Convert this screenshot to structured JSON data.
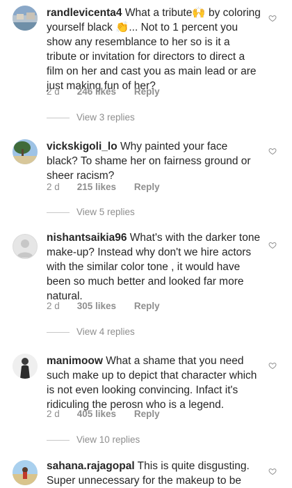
{
  "comments": [
    {
      "username": "randlevicenta4",
      "text": "What a tribute🙌 by coloring yourself black 👏... Not to 1 percent you show any resemblance to her so is it a tribute or invitation for directors to direct a film on her and cast you as main lead or are just making fun of her?",
      "age": "2 d",
      "likes": "246 likes",
      "reply": "Reply",
      "replies": "View 3 replies"
    },
    {
      "username": "vickskigoli_lo",
      "text": "Why painted your face black? To shame her on fairness ground or sheer racism?",
      "age": "2 d",
      "likes": "215 likes",
      "reply": "Reply",
      "replies": "View 5 replies"
    },
    {
      "username": "nishantsaikia96",
      "text": "What's with the darker tone make-up? Instead why don't we hire actors with the similar color tone , it would have been so much better and looked far more natural.",
      "age": "2 d",
      "likes": "305 likes",
      "reply": "Reply",
      "replies": "View 4 replies"
    },
    {
      "username": "manimoow",
      "text": "What a shame that you need such make up to depict that character which is not even looking convincing. Infact it's ridiculing the perosn who is a legend.",
      "age": "2 d",
      "likes": "405 likes",
      "reply": "Reply",
      "replies": "View 10 replies"
    },
    {
      "username": "sahana.rajagopal",
      "text": "This is quite disgusting. Super unnecessary for the makeup to be"
    }
  ],
  "icons": {
    "like": "heart-outline-icon"
  },
  "colors": {
    "text": "#262626",
    "secondary": "#8e8e8e",
    "divider": "#c7c7c7"
  }
}
